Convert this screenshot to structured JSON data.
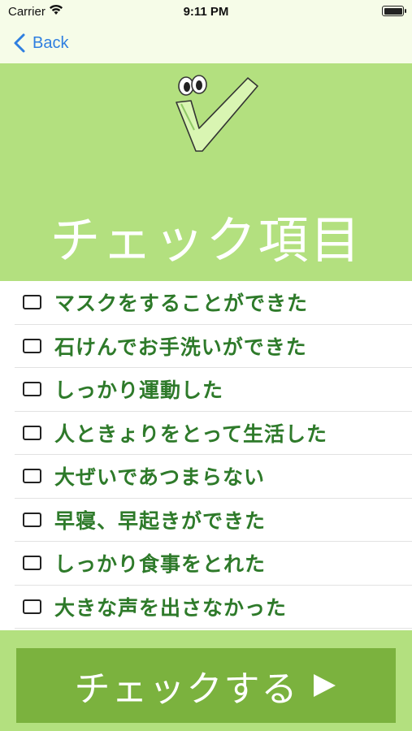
{
  "status_bar": {
    "carrier": "Carrier",
    "time": "9:11 PM"
  },
  "nav": {
    "back_label": "Back"
  },
  "header": {
    "title": "チェック項目"
  },
  "checklist": {
    "items": [
      {
        "label": "マスクをすることができた",
        "checked": false
      },
      {
        "label": "石けんでお手洗いができた",
        "checked": false
      },
      {
        "label": "しっかり運動した",
        "checked": false
      },
      {
        "label": "人ときょりをとって生活した",
        "checked": false
      },
      {
        "label": "大ぜいであつまらない",
        "checked": false
      },
      {
        "label": "早寝、早起きができた",
        "checked": false
      },
      {
        "label": "しっかり食事をとれた",
        "checked": false
      },
      {
        "label": "大きな声を出さなかった",
        "checked": false
      }
    ]
  },
  "footer": {
    "check_button_label": "チェックする"
  },
  "colors": {
    "background": "#b3e07f",
    "bar": "#f6fce8",
    "item_text": "#2e7a2a",
    "button": "#7bb23e",
    "link": "#2f7fe0"
  },
  "icons": [
    "wifi-icon",
    "battery-icon",
    "back-chevron-icon",
    "checkmark-mascot-icon",
    "checkbox-icon",
    "play-icon"
  ]
}
